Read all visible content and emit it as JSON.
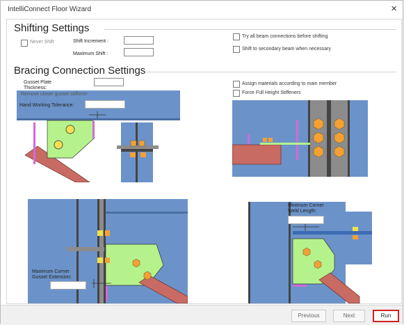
{
  "window": {
    "title": "IntelliConnect Floor Wizard",
    "close_glyph": "×"
  },
  "shifting": {
    "title": "Shifting Settings",
    "never_shift": "Never Shift",
    "shift_increment": "Shift Increment :",
    "maximum_shift": "Maximum Shift :",
    "try_all": "Try all beam connections before shifting",
    "shift_secondary": "Shift to secondary beam when necessary"
  },
  "bracing": {
    "title": "Bracing Connection Settings",
    "gusset_plate_l1": "Gusset Plate",
    "gusset_plate_l2": "Thickness:",
    "remove_closer": "Remove closer gusset stiffener",
    "hand_working": "Hand Working Tolerance:",
    "assign_materials": "Assign materials according to main member",
    "force_full": "Force Full Height Stiffeners",
    "min_corner_l1": "Minimum Corner",
    "min_corner_l2": "Weld Length:",
    "max_corner_l1": "Maximum Corner",
    "max_corner_l2": "Gusset Extension:"
  },
  "buttons": {
    "previous": "Previous",
    "next": "Next",
    "run": "Run"
  },
  "colors": {
    "beam": "#6b93c9",
    "gusset": "#b6f28c",
    "brace": "#c86b63",
    "bolt": "#f4a033",
    "web": "#8c8c8c"
  }
}
